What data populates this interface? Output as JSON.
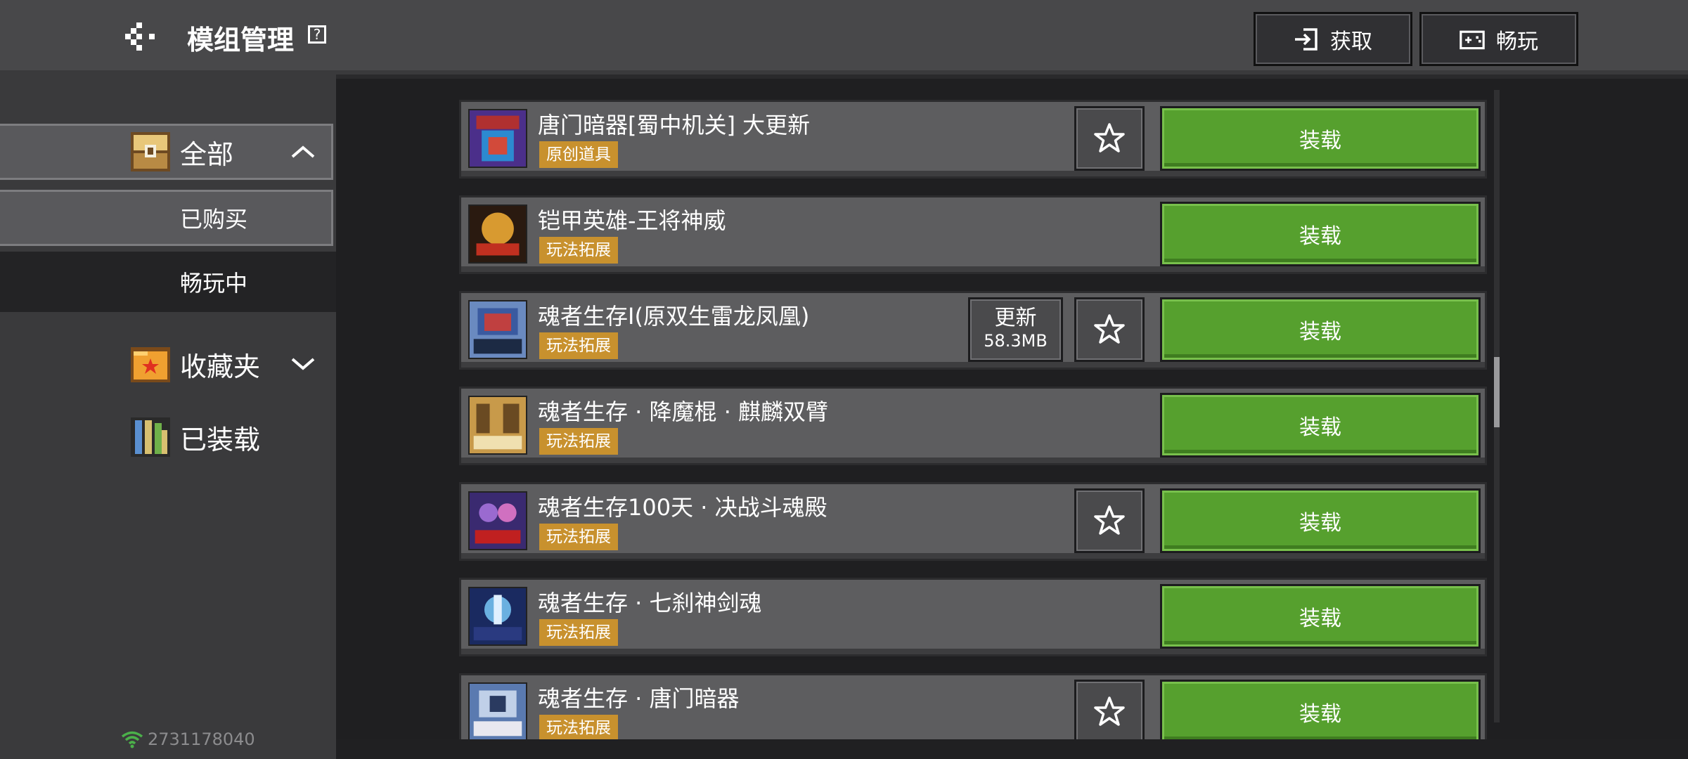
{
  "header": {
    "title": "模组管理",
    "help_label": "?",
    "get_label": "获取",
    "play_label": "畅玩"
  },
  "sidebar": {
    "all_label": "全部",
    "bought_label": "已购买",
    "playing_label": "畅玩中",
    "favorites_label": "收藏夹",
    "loaded_label": "已装载"
  },
  "status": {
    "user_id": "2731178040"
  },
  "mods": [
    {
      "name": "唐门暗器[蜀中机关] 大更新",
      "tag": "原创道具",
      "has_star": true,
      "action": "装载"
    },
    {
      "name": "铠甲英雄-王将神威",
      "tag": "玩法拓展",
      "has_star": false,
      "action": "装载"
    },
    {
      "name": "魂者生存I(原双生雷龙凤凰)",
      "tag": "玩法拓展",
      "has_star": true,
      "update_label": "更新",
      "update_size": "58.3MB",
      "action": "装载"
    },
    {
      "name": "魂者生存 · 降魔棍 · 麒麟双臂",
      "tag": "玩法拓展",
      "has_star": false,
      "action": "装载"
    },
    {
      "name": "魂者生存100天 · 决战斗魂殿",
      "tag": "玩法拓展",
      "has_star": true,
      "action": "装载"
    },
    {
      "name": "魂者生存 · 七刹神剑魂",
      "tag": "玩法拓展",
      "has_star": false,
      "action": "装载"
    },
    {
      "name": "魂者生存 · 唐门暗器",
      "tag": "玩法拓展",
      "has_star": true,
      "action": "装载"
    }
  ],
  "colors": {
    "load_green": "#56a02e",
    "tag_orange": "#c8912e",
    "header_bg": "#48484a",
    "sidebar_bg": "#3a3a3c"
  }
}
